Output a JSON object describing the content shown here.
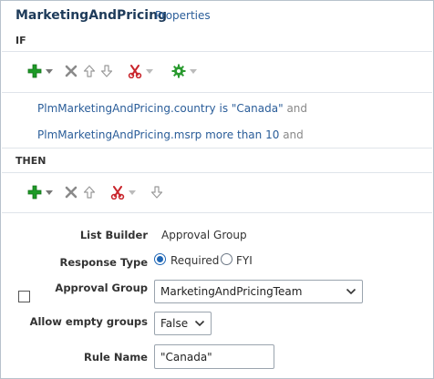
{
  "header": {
    "title": "MarketingAndPricing",
    "properties_link": "Properties"
  },
  "if_section": {
    "label": "IF",
    "toolbar": {
      "add_icon": "green-plus-icon",
      "delete_icon": "delete-x-icon",
      "move_up_icon": "arrow-up-icon",
      "move_down_icon": "arrow-down-icon",
      "cut_icon": "scissors-icon",
      "advanced_icon": "green-gear-icon"
    },
    "conditions": [
      {
        "attribute": "PlmMarketingAndPricing.country",
        "operator": "is",
        "value": "\"Canada\"",
        "connector": "and"
      },
      {
        "attribute": "PlmMarketingAndPricing.msrp",
        "operator": "more than",
        "value": "10",
        "connector": "and"
      }
    ]
  },
  "then_section": {
    "label": "THEN",
    "toolbar": {
      "add_icon": "green-plus-icon",
      "delete_icon": "delete-x-icon",
      "move_up_icon": "arrow-up-icon",
      "cut_icon": "scissors-icon",
      "move_down_icon": "arrow-down-icon"
    },
    "action": {
      "list_builder_label": "List Builder",
      "list_builder_value": "Approval Group",
      "response_type_label": "Response Type",
      "response_options": [
        "Required",
        "FYI"
      ],
      "response_selected": "Required",
      "approval_group_label": "Approval Group",
      "approval_group_value": "MarketingAndPricingTeam",
      "allow_empty_label": "Allow empty groups",
      "allow_empty_value": "False",
      "rule_name_label": "Rule Name",
      "rule_name_value": "\"Canada\""
    }
  },
  "colors": {
    "link": "#2a5d99",
    "title": "#1e3b5a",
    "radio_selected": "#1f66b5",
    "add_green": "#1d9a26",
    "cut_red": "#c9252c"
  }
}
